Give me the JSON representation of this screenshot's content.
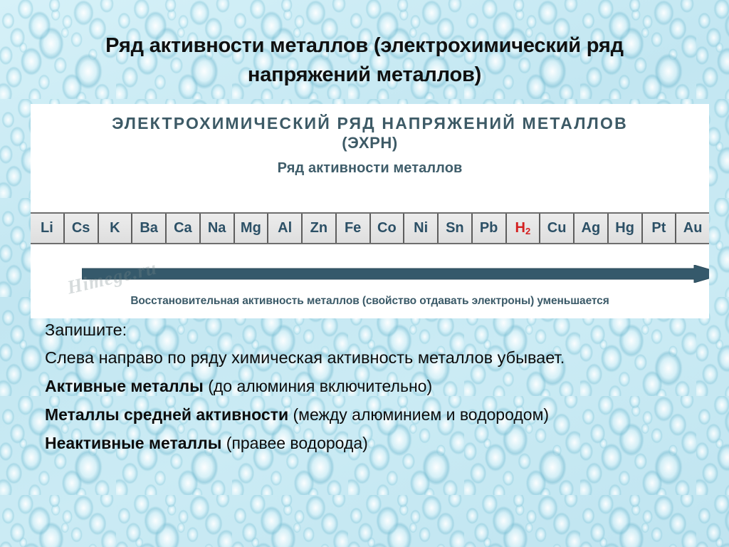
{
  "slide": {
    "title": "Ряд активности металлов (электрохимический ряд напряжений металлов)"
  },
  "panel": {
    "title_main": "ЭЛЕКТРОХИМИЧЕСКИЙ РЯД НАПРЯЖЕНИЙ МЕТАЛЛОВ",
    "title_abbr": "(ЭХРН)",
    "subtitle": "Ряд активности металлов",
    "caption": "Восстановительная активность металлов (свойство отдавать электроны) уменьшается",
    "watermark": "Himege.ru",
    "arrow_direction": "right",
    "arrow_color": "#35596b"
  },
  "metals": [
    {
      "symbol": "Li",
      "sub": "",
      "highlight": false
    },
    {
      "symbol": "Cs",
      "sub": "",
      "highlight": false
    },
    {
      "symbol": "K",
      "sub": "",
      "highlight": false
    },
    {
      "symbol": "Ba",
      "sub": "",
      "highlight": false
    },
    {
      "symbol": "Ca",
      "sub": "",
      "highlight": false
    },
    {
      "symbol": "Na",
      "sub": "",
      "highlight": false
    },
    {
      "symbol": "Mg",
      "sub": "",
      "highlight": false
    },
    {
      "symbol": "Al",
      "sub": "",
      "highlight": false
    },
    {
      "symbol": "Zn",
      "sub": "",
      "highlight": false
    },
    {
      "symbol": "Fe",
      "sub": "",
      "highlight": false
    },
    {
      "symbol": "Co",
      "sub": "",
      "highlight": false
    },
    {
      "symbol": "Ni",
      "sub": "",
      "highlight": false
    },
    {
      "symbol": "Sn",
      "sub": "",
      "highlight": false
    },
    {
      "symbol": "Pb",
      "sub": "",
      "highlight": false
    },
    {
      "symbol": "H",
      "sub": "2",
      "highlight": true
    },
    {
      "symbol": "Cu",
      "sub": "",
      "highlight": false
    },
    {
      "symbol": "Ag",
      "sub": "",
      "highlight": false
    },
    {
      "symbol": "Hg",
      "sub": "",
      "highlight": false
    },
    {
      "symbol": "Pt",
      "sub": "",
      "highlight": false
    },
    {
      "symbol": "Au",
      "sub": "",
      "highlight": false
    }
  ],
  "notes": {
    "zapishite": "Запишите:",
    "rule": "Слева направо по ряду химическая активность металлов убывает.",
    "active_lead": "Активные металлы",
    "active_rest": " (до алюминия включительно)",
    "medium_lead": "Металлы средней активности",
    "medium_rest": " (между алюминием и водородом)",
    "inactive_lead": "Неактивные металлы",
    "inactive_rest": " (правее водорода)"
  },
  "colors": {
    "background": "#c8eaf3",
    "panel": "#ffffff",
    "band": "#e6e6e6",
    "metal_text": "#2c5066",
    "hydrogen_text": "#d41f1f",
    "heading_text": "#3d5a66",
    "arrow": "#35596b"
  }
}
